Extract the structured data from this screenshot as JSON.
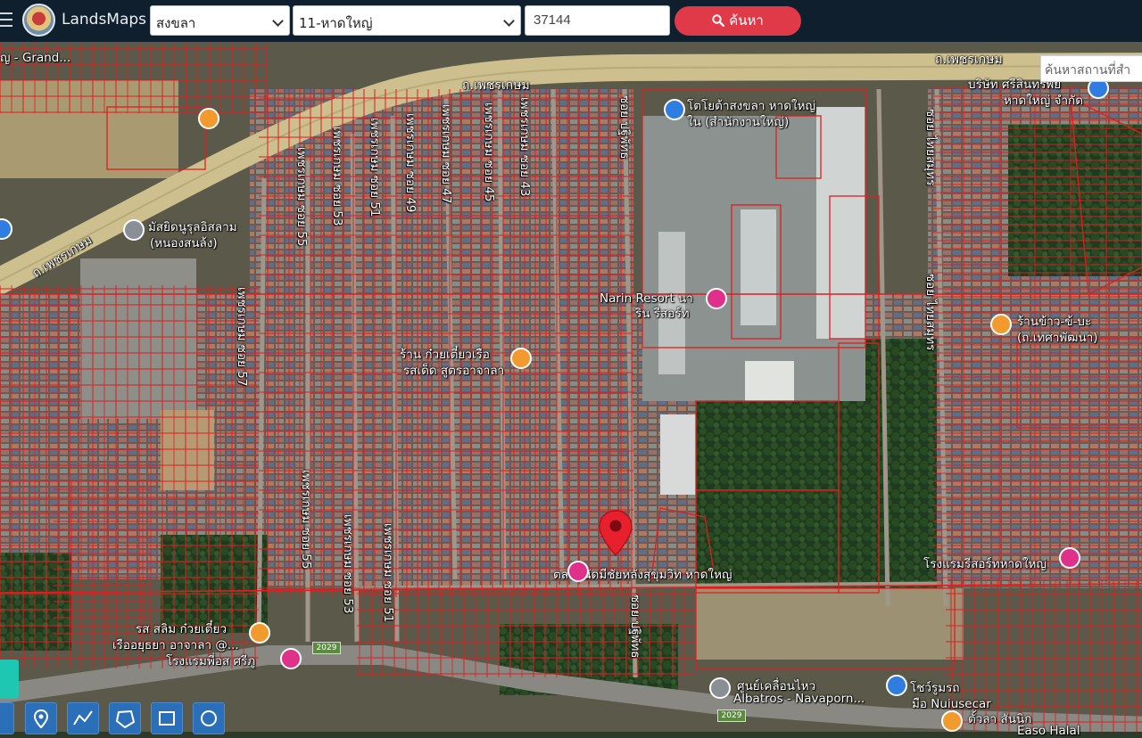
{
  "header": {
    "brand": "LandsMaps",
    "province": "สงขลา",
    "district": "11-หาดใหญ่",
    "parcel_no": "37144",
    "search_label": "ค้นหา"
  },
  "map": {
    "place_search_placeholder": "ค้นหาสถานที่สำ",
    "roads": {
      "phetkasem_top": "ถ.เพชรเกษม",
      "phetkasem_top2": "ถ.เพชรเกษม",
      "phetkasem_left": "ถ.เพชรเกษม",
      "soi_57": "เพชรเกษม ซอย 57",
      "soi_55_upper": "เพชรเกษม ซอย 55",
      "soi_53_upper": "เพชรเกษม ซอย 53",
      "soi_51_upper": "เพชรเกษม ซอย 51",
      "soi_49": "เพชรเกษม ซอย 49",
      "soi_47": "เพชรเกษม ซอย 47",
      "soi_45": "เพชรเกษม ซอย 45",
      "soi_43": "เพชรเกษม ซอย 43",
      "soi_55_lower": "เพชรเกษม ซอย 55",
      "soi_53_lower": "เพชรเกษม ซอย 53",
      "soi_51_lower": "เพชรเกษม ซอย 51",
      "soi_pattana": "ซอย ปฐิพัทธ",
      "soi_right": "ซอย ไทยสมุทร",
      "soi_bottom": "ซอย ปฐิพัทธ",
      "route_2029_a": "2029",
      "route_2029_b": "2029"
    },
    "places": {
      "grand": "ญ - Grand...",
      "toyota": "โตโยต้าสงขลา หาดใหญ่",
      "toyota2": "ใน (สำนักงานใหญ่)",
      "company": "บริษัท ศรีสินทรัพย์",
      "company2": "หาดใหญ่ จำกัด",
      "mosque": "มัสยิดนูรุลอิสลาม",
      "mosque2": "(หนองสนล้ง)",
      "narin": "Narin Resort นา",
      "narin2": "ริน รีสอร์ท",
      "noodle": "ร้าน ก๋วยเตี๋ยวเรือ",
      "noodle2": "รสเด็ด สูตรอาจาลา",
      "kinon": "ร้านข้าว-ข้-บะ",
      "kinon2": "(ถ.เทศาพัฒนา)",
      "market": "ตลาดนัดมีชัยหลังสุขุมวิท หาดใหญ่",
      "hotel_right": "โรงแรมรีสอร์ทหาดใหญ่",
      "rot_salim": "รส สลิม ก๋วยเตี๋ยว",
      "rot_salim2": "เรืออยุธยา อาจาลา @...",
      "hotel_left": "โรงแรมพี่อส ศรีภู",
      "albatros": "ศูนย์เคลื่อนไหว",
      "albatros2": "Albatros - Navaporn...",
      "nuisecar": "โชว์รูมรถ",
      "nuisecar2": "มือ Nuiusecar",
      "halal": "ตั้วลา สันนิก",
      "halal2": "Easo Halal"
    }
  },
  "colors": {
    "topbar": "#0f1f2e",
    "search_button": "#e03a48",
    "parcel_line": "#e01e1e",
    "marker": "#e8202e",
    "tool": "#2b6fb8"
  },
  "icons": {
    "search": "search-icon",
    "marker": "location-marker-icon",
    "tools": [
      "map-pin-tool-icon",
      "polyline-tool-icon",
      "polygon-tool-icon",
      "rectangle-tool-icon",
      "circle-tool-icon"
    ]
  }
}
